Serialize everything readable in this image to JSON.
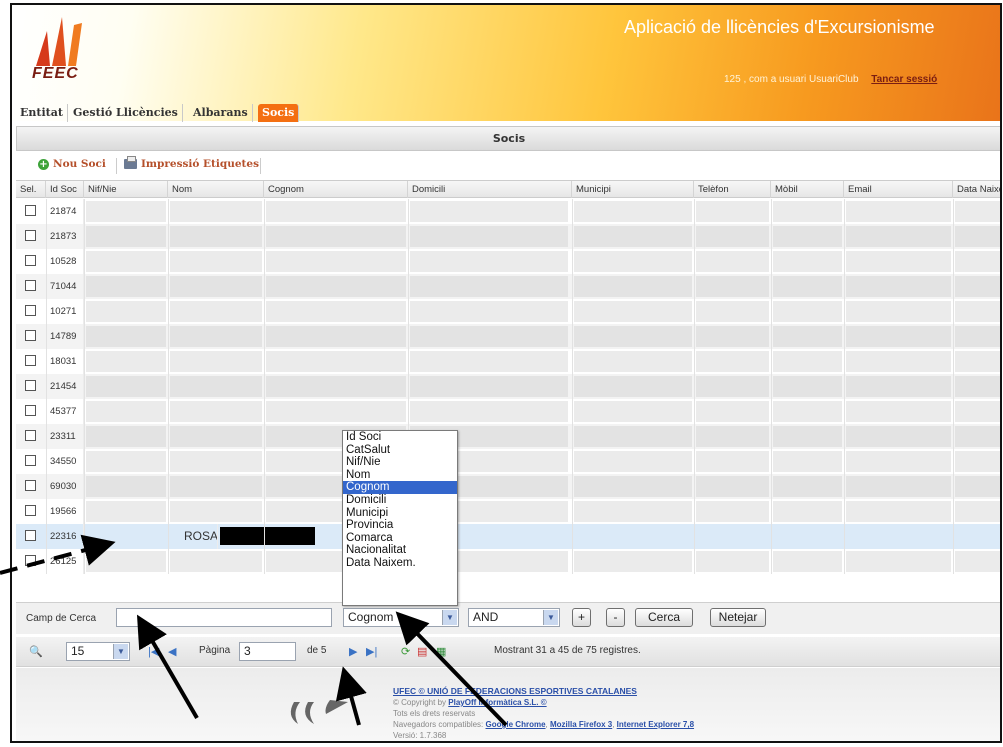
{
  "header": {
    "logo_text": "FEEC",
    "app_title": "Aplicació de llicències d'Excursionisme",
    "user_info": "125 , com a usuari  UsuariClub",
    "logout_label": "Tancar sessió"
  },
  "tabs": [
    {
      "label": "Entitat",
      "active": false
    },
    {
      "label": "Gestió Llicències",
      "active": false
    },
    {
      "label": "Albarans",
      "active": false
    },
    {
      "label": "Socis",
      "active": true
    }
  ],
  "section_title": "Socis",
  "toolbar": {
    "new_member_label": "Nou Soci",
    "print_labels_label": "Impressió Etiquetes"
  },
  "grid": {
    "columns": [
      "Sel.",
      "Id Soc",
      "Nif/Nie",
      "Nom",
      "Cognom",
      "Domicili",
      "Municipi",
      "Telèfon",
      "Mòbil",
      "Email",
      "Data Naixement"
    ],
    "rows": [
      {
        "id": "21874",
        "nom": ""
      },
      {
        "id": "21873",
        "nom": ""
      },
      {
        "id": "10528",
        "nom": ""
      },
      {
        "id": "71044",
        "nom": ""
      },
      {
        "id": "10271",
        "nom": ""
      },
      {
        "id": "14789",
        "nom": ""
      },
      {
        "id": "18031",
        "nom": ""
      },
      {
        "id": "21454",
        "nom": ""
      },
      {
        "id": "45377",
        "nom": ""
      },
      {
        "id": "23311",
        "nom": ""
      },
      {
        "id": "34550",
        "nom": ""
      },
      {
        "id": "69030",
        "nom": ""
      },
      {
        "id": "19566",
        "nom": ""
      },
      {
        "id": "22316",
        "nom": "ROSA"
      },
      {
        "id": "26125",
        "nom": ""
      }
    ],
    "selected_row": 13
  },
  "field_dropdown": {
    "options": [
      "Id Soci",
      "CatSalut",
      "Nif/Nie",
      "Nom",
      "Cognom",
      "Domicili",
      "Municipi",
      "Provincia",
      "Comarca",
      "Nacionalitat",
      "Data Naixem."
    ],
    "highlighted": "Cognom"
  },
  "search": {
    "label": "Camp de Cerca",
    "value": "",
    "field_selected": "Cognom",
    "operator_selected": "AND",
    "add_label": "+",
    "remove_label": "-",
    "search_label": "Cerca",
    "clear_label": "Netejar"
  },
  "pager": {
    "page_size": "15",
    "page_label": "Pàgina",
    "page_value": "3",
    "total_pages": "de 5",
    "status": "Mostrant 31 a 45 de 75 registres."
  },
  "footer": {
    "org_line": "UFEC © UNIÓ DE FEDERACIONS ESPORTIVES CATALANES",
    "copyright_prefix": "© Copyright by",
    "company_link": "PlayOff Informàtica S.L. ©",
    "rights": "Tots els drets reservats",
    "browsers_prefix": "Navegadors compatibles:",
    "browser_chrome": "Google Chrome",
    "browser_firefox": "Mozilla Firefox 3",
    "browser_ie": "Internet Explorer 7,8",
    "version": "Versió: 1.7.368"
  },
  "colors": {
    "accent_orange": "#f46f12",
    "selection_blue": "#3366cc",
    "link_blue": "#2a4fa8"
  }
}
